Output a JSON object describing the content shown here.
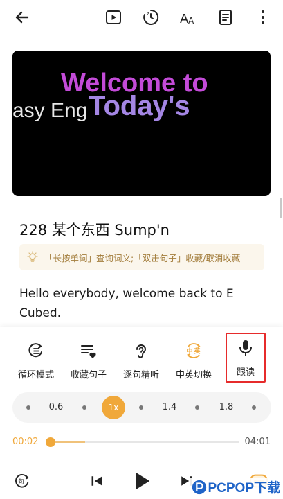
{
  "video": {
    "line1": "Welcome to",
    "line2a": "asy Eng",
    "line2b": "Today's"
  },
  "lesson": {
    "title": "228 某个东西 Sump'n",
    "tip": "「长按单词」查询词义;「双击句子」收藏/取消收藏",
    "sentence": "Hello everybody, welcome back to E Cubed."
  },
  "functions": [
    {
      "label": "循环模式",
      "icon": "loop-mode-icon"
    },
    {
      "label": "收藏句子",
      "icon": "favorite-sentence-icon"
    },
    {
      "label": "逐句精听",
      "icon": "ear-icon"
    },
    {
      "label": "中英切换",
      "icon": "language-switch-icon",
      "badge_cn": "中",
      "badge_en": "英"
    },
    {
      "label": "跟读",
      "icon": "microphone-icon"
    }
  ],
  "speed": {
    "options": [
      "0.6",
      "1x",
      "1.4",
      "1.8"
    ],
    "selected": "1x"
  },
  "playback": {
    "current": "00:02",
    "total": "04:01",
    "progress": 0.008
  },
  "watermark": {
    "text": "PCPOP下载",
    "sub": "PCPOP.com"
  },
  "colors": {
    "accent": "#f0a83a",
    "highlight_border": "#e62b2b",
    "tip_text": "#a37d3c"
  }
}
